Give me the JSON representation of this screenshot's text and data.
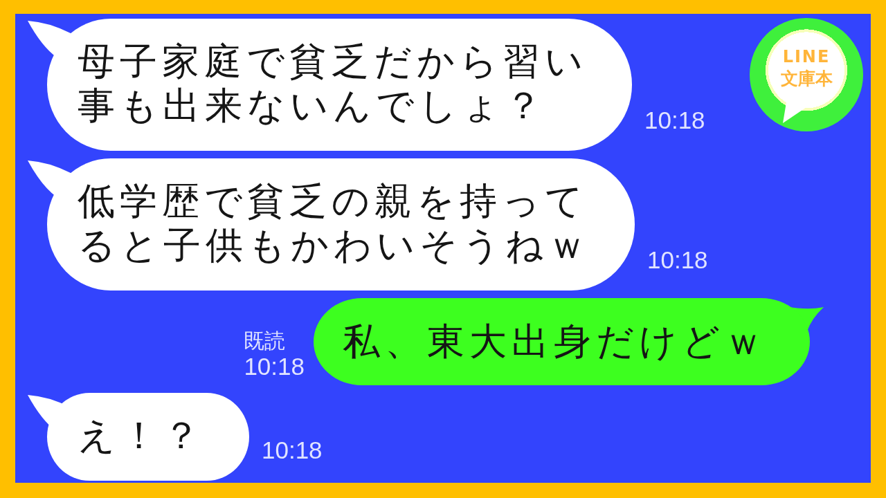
{
  "logo": {
    "lines": [
      "LINE",
      "文庫本"
    ]
  },
  "messages": [
    {
      "kind": "incoming",
      "lines": [
        "母子家庭で貧乏だから習い",
        "事も出来ないんでしょ？"
      ],
      "time": "10:18"
    },
    {
      "kind": "incoming",
      "lines": [
        "低学歴で貧乏の親を持って",
        "ると子供もかわいそうねｗ"
      ],
      "time": "10:18"
    },
    {
      "kind": "outgoing",
      "lines": [
        "私、東大出身だけどｗ"
      ],
      "read_label": "既読",
      "time": "10:18"
    },
    {
      "kind": "incoming",
      "lines": [
        "え！？"
      ],
      "time": "10:18"
    }
  ]
}
